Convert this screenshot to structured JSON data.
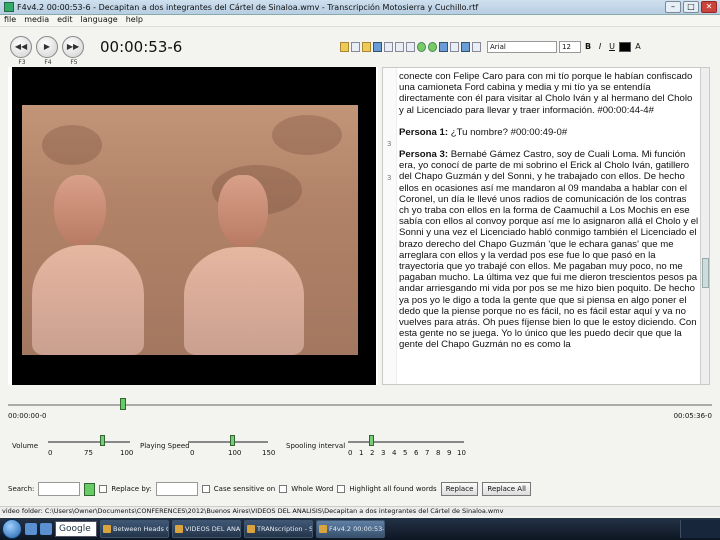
{
  "window": {
    "title": "F4v4.2 00:00:53-6 - Decapitan a dos integrantes del Cártel de Sinaloa.wmv - Transcripción Motosierra y Cuchillo.rtf"
  },
  "menu": [
    "file",
    "media",
    "edit",
    "language",
    "help"
  ],
  "player": {
    "rewind_label": "F3",
    "play_label": "F4",
    "forward_label": "F5",
    "timecode": "00:00:53-6"
  },
  "format_bar": {
    "font": "Arial",
    "size": "12",
    "bold": "B",
    "italic": "I",
    "underline": "U",
    "font_color_label": "A"
  },
  "transcript": {
    "line_numbers": [
      "3",
      "3"
    ],
    "p1": "conecte con Felipe Caro para con mi tío porque le habían confiscado una camioneta Ford cabina y media y mi tío ya se entendía directamente con él para visitar al Cholo Iván y al hermano del Cholo y al Licenciado para llevar y traer información. #00:00:44-4#",
    "p2_speaker": "Persona 1:",
    "p2_text": " ¿Tu nombre? #00:00:49-0#",
    "p3_speaker": "Persona 3:",
    "p3_text": " Bernabé Gámez Castro, soy de Cuali Loma. Mi función era, yo conocí de parte de mi sobrino el Erick al Cholo Iván, gatillero del Chapo Guzmán y del Sonni, y he trabajado con ellos. De hecho ellos en ocasiones así me mandaron al 09 mandaba a hablar con el Coronel, un día le llevé unos radios de comunicación de los contras ch yo traba con ellos en la forma de Caamuchil a Los Mochis en ese sabía con ellos al convoy porque así me lo asignaron allá el Cholo y el Sonni y una vez el Licenciado habló conmigo también el Licenciado el brazo derecho del Chapo Guzmán 'que le echara ganas' que me arreglara con ellos y la verdad pos ese fue lo que pasó en la trayectoria que yo trabajé con ellos. Me pagaban muy poco, no me pagaban mucho. La última vez que fui me dieron trescientos pesos pa andar arriesgando mi vida por pos se me hizo bien poquito. De hecho ya pos yo le digo a toda la gente que que si piensa en algo poner el dedo que la piense porque no es fácil, no es fácil estar aquí y va no vuelves para atrás. Oh pues fíjense bien lo que le estoy diciendo. Con esta gente no se juega. Yo lo único que les puedo decir que que la gente del Chapo Guzmán no es como la"
  },
  "timeline": {
    "start": "00:00:00-0",
    "end": "00:05:36-0",
    "position_fraction": 0.16
  },
  "sliders": {
    "volume": {
      "label": "Volume",
      "ticks": [
        "0",
        "75",
        "100"
      ],
      "value": 75
    },
    "playing_speed": {
      "label": "Playing Speed",
      "ticks": [
        "0",
        "100",
        "150"
      ],
      "value": 100
    },
    "spooling_interval": {
      "label": "Spooling interval",
      "ticks": [
        "0",
        "1",
        "2",
        "3",
        "4",
        "5",
        "6",
        "7",
        "8",
        "9",
        "10"
      ],
      "value": 2
    }
  },
  "search": {
    "search_label": "Search:",
    "replace_label": "Replace by:",
    "case_label": "Case sensitive on",
    "whole_label": "Whole Word",
    "highlight_label": "Highlight all found words",
    "replace_btn": "Replace",
    "replace_all_btn": "Replace All"
  },
  "status": "video folder: C:\\Users\\Owner\\Documents\\CONFERENCES\\2012\\Buenos Aires\\VIDEOS DEL ANALISIS\\Decapitan a dos integrantes del Cártel de Sinaloa.wmv",
  "taskbar": {
    "google": "Google",
    "tasks": [
      "Between Heads Cor...",
      "VIDEOS DEL ANALISIS",
      "TRANscription - So...",
      "F4v4.2 00:00:53-6 - ..."
    ]
  }
}
